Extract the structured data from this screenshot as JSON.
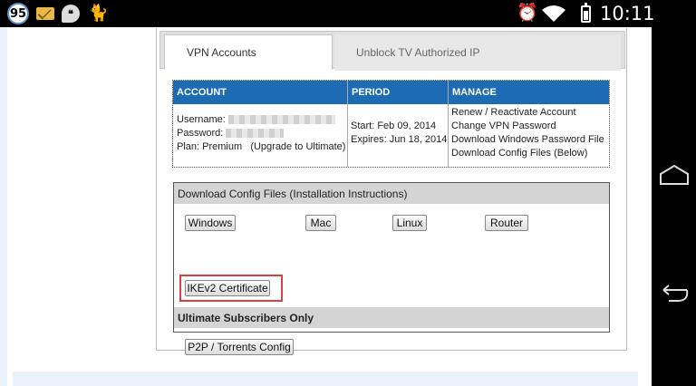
{
  "status_bar": {
    "badge_count": "95",
    "time": "10:11",
    "icons": [
      "badge-icon",
      "mail-icon",
      "hangouts-icon",
      "cat-icon",
      "alarm-icon",
      "wifi-icon",
      "battery-icon"
    ]
  },
  "tabs": [
    {
      "label": "VPN Accounts",
      "active": true
    },
    {
      "label": "Unblock TV Authorized IP",
      "active": false
    }
  ],
  "accounts": {
    "headers": {
      "account": "ACCOUNT",
      "period": "PERIOD",
      "manage": "MANAGE"
    },
    "username_label": "Username:",
    "password_label": "Password:",
    "plan_text": "Plan: Premium",
    "upgrade_link": "(Upgrade to Ultimate)",
    "start": "Start: Feb 09, 2014",
    "expires": "Expires: Jun 18, 2014",
    "manage_links": [
      "Renew / Reactivate Account",
      "Change VPN Password",
      "Download Windows Password File",
      "Download Config Files (Below)"
    ]
  },
  "downloads": {
    "heading_bold": "Download Config Files",
    "heading_link": "(Installation Instructions)",
    "buttons": [
      "Windows",
      "Mac",
      "Linux",
      "Router"
    ],
    "ikev2_label": "IKEv2 Certificate",
    "ultimate_heading": "Ultimate Subscribers Only",
    "p2p_label": "P2P / Torrents Config"
  },
  "colors": {
    "header_blue": "#1c6bb3",
    "highlight_red": "#d64040"
  }
}
